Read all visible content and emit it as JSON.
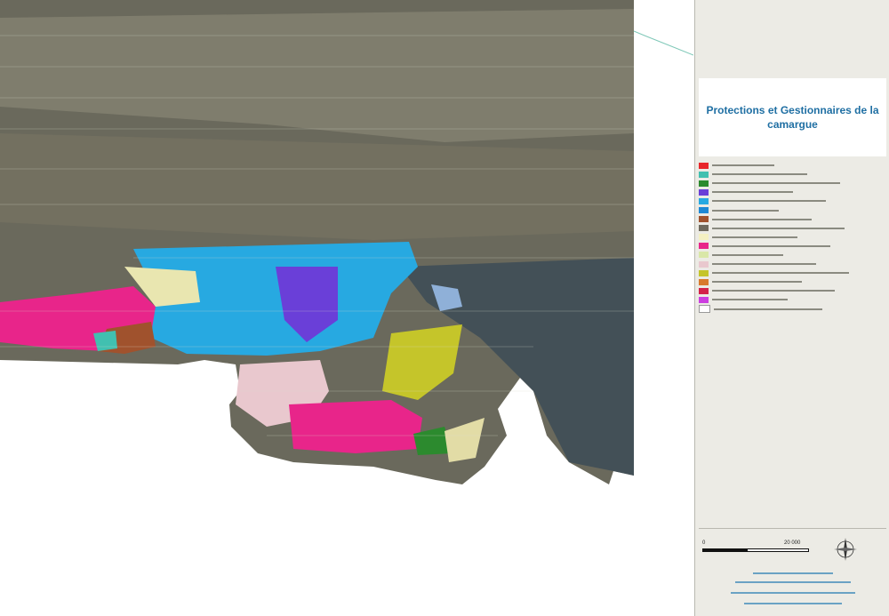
{
  "map_title": "Protections et Gestionnaires de la camargue",
  "colors": {
    "panel_bg": "#ecebe5",
    "title_text": "#1f6fa3",
    "terrain_dark": "#5f5e52",
    "terrain_light": "#8f8b79",
    "sea": "#3c4d55"
  },
  "legend": [
    {
      "color": "#e8262b"
    },
    {
      "color": "#41c0b0"
    },
    {
      "color": "#2c8a2e"
    },
    {
      "color": "#6a3fd8"
    },
    {
      "color": "#27a9e1"
    },
    {
      "color": "#1e88d4"
    },
    {
      "color": "#a0522d"
    },
    {
      "color": "#6f6a5e"
    },
    {
      "color": "#f4f0c2"
    },
    {
      "color": "#e8258a"
    },
    {
      "color": "#d9e7a8"
    },
    {
      "color": "#e9c8ce"
    },
    {
      "color": "#c5c52a"
    },
    {
      "color": "#d87a2c"
    },
    {
      "color": "#d3234a"
    },
    {
      "color": "#cc3fe0"
    },
    {
      "color": "#ffffff"
    }
  ],
  "scale": {
    "start_label": "0",
    "end_label": "20 000"
  },
  "compass_icon": "compass-rose-icon"
}
